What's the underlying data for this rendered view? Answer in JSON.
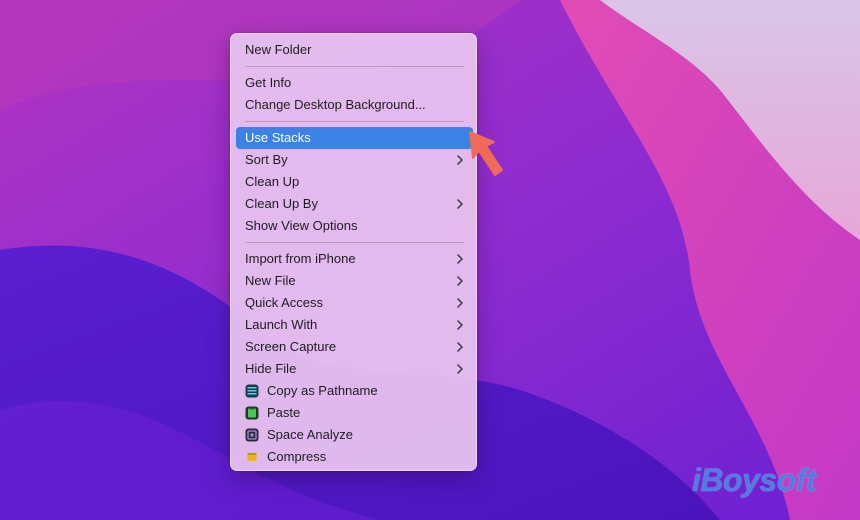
{
  "menu": {
    "items": [
      {
        "label": "New Folder"
      },
      {
        "label": "Get Info"
      },
      {
        "label": "Change Desktop Background..."
      },
      {
        "label": "Use Stacks",
        "highlighted": true
      },
      {
        "label": "Sort By",
        "submenu": true
      },
      {
        "label": "Clean Up"
      },
      {
        "label": "Clean Up By",
        "submenu": true
      },
      {
        "label": "Show View Options"
      },
      {
        "label": "Import from iPhone",
        "submenu": true
      },
      {
        "label": "New File",
        "submenu": true
      },
      {
        "label": "Quick Access",
        "submenu": true
      },
      {
        "label": "Launch With",
        "submenu": true
      },
      {
        "label": "Screen Capture",
        "submenu": true
      },
      {
        "label": "Hide File",
        "submenu": true
      },
      {
        "label": "Copy as Pathname",
        "icon": "copy-pathname-icon"
      },
      {
        "label": "Paste",
        "icon": "paste-icon"
      },
      {
        "label": "Space Analyze",
        "icon": "space-analyze-icon"
      },
      {
        "label": "Compress",
        "icon": "compress-icon"
      }
    ]
  },
  "watermark": {
    "text": "iBoysoft"
  },
  "colors": {
    "highlight": "#3a82e6",
    "arrow": "#f06a5a",
    "watermark": "#4e7fe0"
  }
}
